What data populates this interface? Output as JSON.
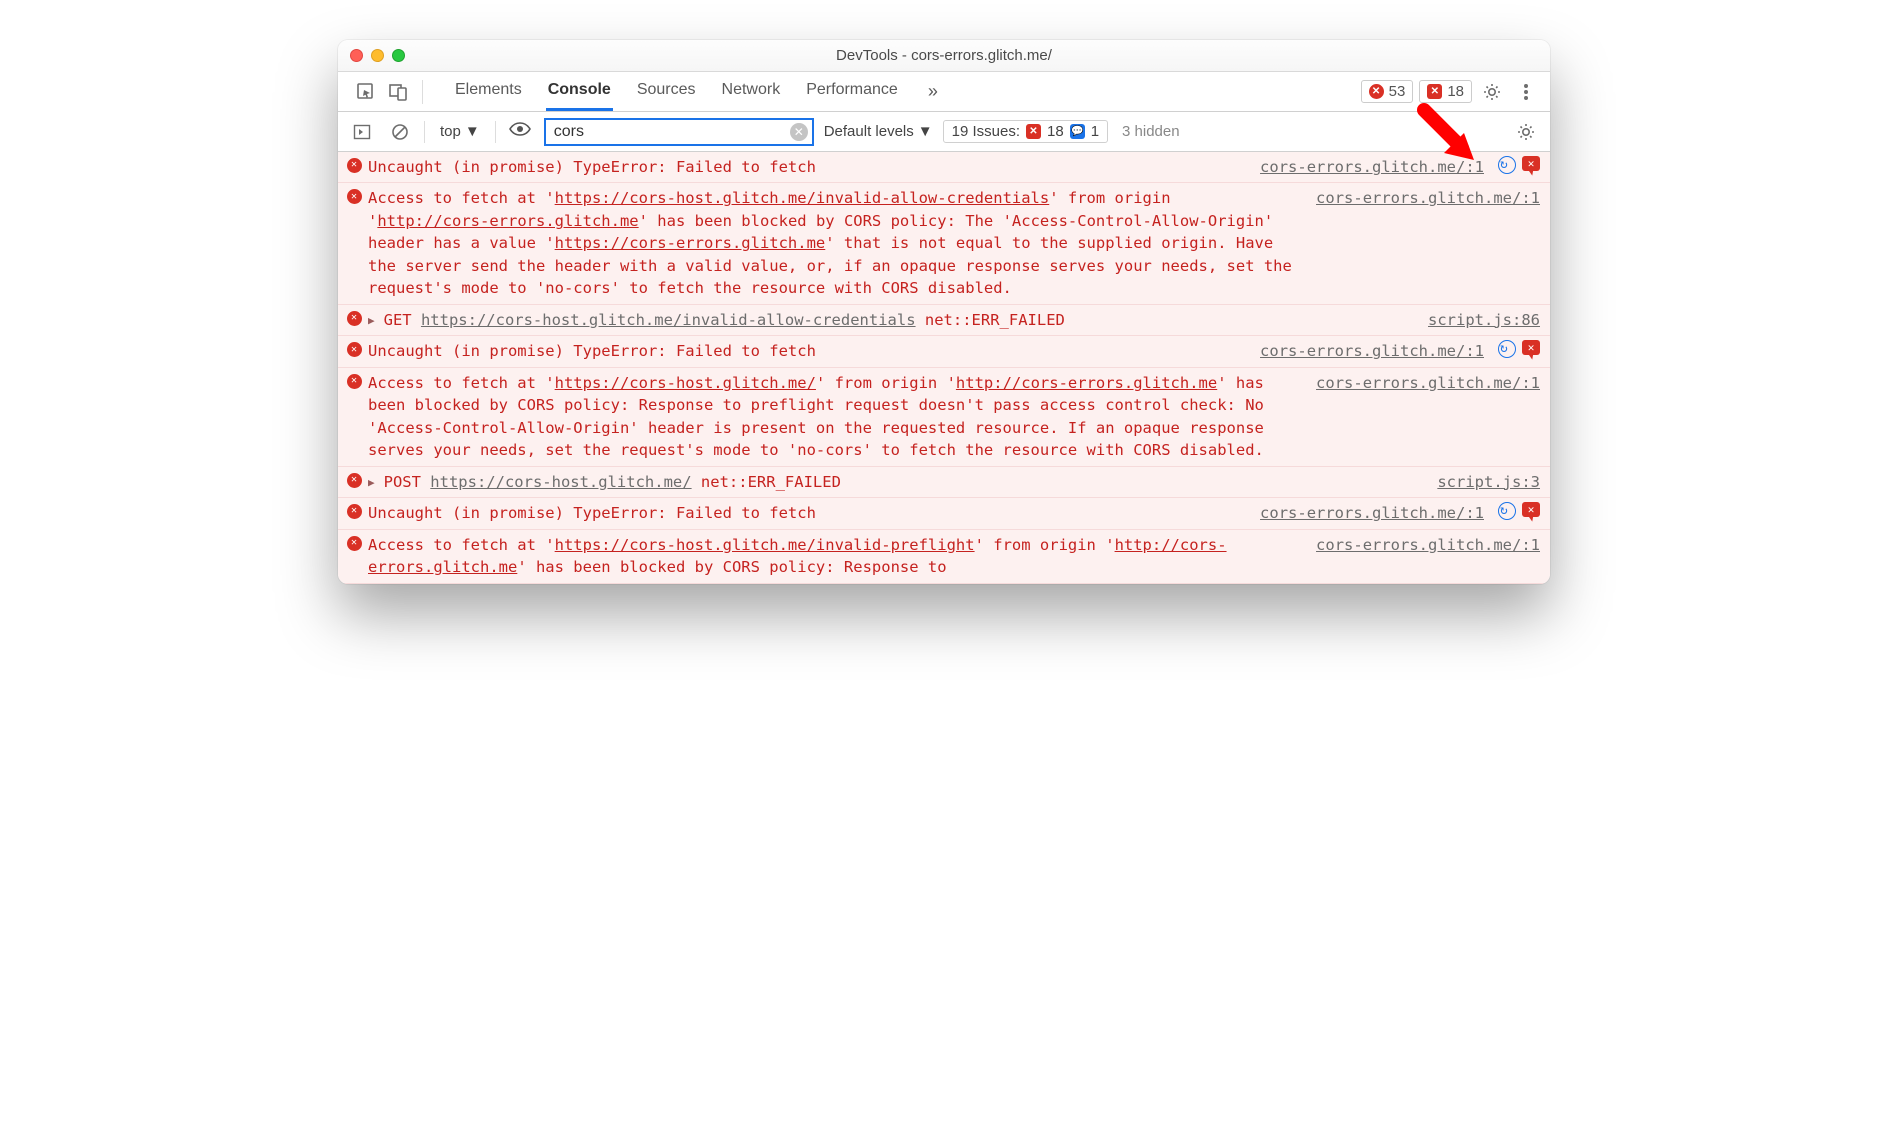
{
  "window": {
    "title": "DevTools - cors-errors.glitch.me/"
  },
  "tabs": {
    "items": [
      "Elements",
      "Console",
      "Sources",
      "Network",
      "Performance"
    ],
    "active_index": 1,
    "more": "»"
  },
  "toolbar_counts": {
    "errors": "53",
    "issues": "18"
  },
  "subtoolbar": {
    "context": "top",
    "filter_value": "cors",
    "levels": "Default levels",
    "issues_label": "19 Issues:",
    "issues_err": "18",
    "issues_msg": "1",
    "hidden": "3 hidden"
  },
  "messages": [
    {
      "kind": "error",
      "text": "Uncaught (in promise) TypeError: Failed to fetch",
      "src": "cors-errors.glitch.me/:1",
      "trail_icons": true
    },
    {
      "kind": "error",
      "segments": [
        {
          "t": "Access to fetch at '"
        },
        {
          "t": "https://cors-host.glitch.me/invalid-allow-credentials",
          "u": true
        },
        {
          "t": "' from origin '"
        },
        {
          "t": "http://cors-errors.glitch.me",
          "u": true
        },
        {
          "t": "' has been blocked by CORS policy: The 'Access-Control-Allow-Origin' header has a value '"
        },
        {
          "t": "https://cors-errors.glitch.me",
          "u": true
        },
        {
          "t": "' that is not equal to the supplied origin. Have the server send the header with a valid value, or, if an opaque response serves your needs, set the request's mode to 'no-cors' to fetch the resource with CORS disabled."
        }
      ],
      "src": "cors-errors.glitch.me/:1"
    },
    {
      "kind": "net",
      "expand": true,
      "method": "GET",
      "url": "https://cors-host.glitch.me/invalid-allow-credentials",
      "status": "net::ERR_FAILED",
      "src": "script.js:86"
    },
    {
      "kind": "error",
      "text": "Uncaught (in promise) TypeError: Failed to fetch",
      "src": "cors-errors.glitch.me/:1",
      "trail_icons": true
    },
    {
      "kind": "error",
      "segments": [
        {
          "t": "Access to fetch at '"
        },
        {
          "t": "https://cors-host.glitch.me/",
          "u": true
        },
        {
          "t": "' from origin '"
        },
        {
          "t": "http://cors-errors.glitch.me",
          "u": true
        },
        {
          "t": "' has been blocked by CORS policy: Response to preflight request doesn't pass access control check: No 'Access-Control-Allow-Origin' header is present on the requested resource. If an opaque response serves your needs, set the request's mode to 'no-cors' to fetch the resource with CORS disabled."
        }
      ],
      "src": "cors-errors.glitch.me/:1"
    },
    {
      "kind": "net",
      "expand": true,
      "method": "POST",
      "url": "https://cors-host.glitch.me/",
      "status": "net::ERR_FAILED",
      "src": "script.js:3"
    },
    {
      "kind": "error",
      "text": "Uncaught (in promise) TypeError: Failed to fetch",
      "src": "cors-errors.glitch.me/:1",
      "trail_icons": true
    },
    {
      "kind": "error",
      "segments": [
        {
          "t": "Access to fetch at '"
        },
        {
          "t": "https://cors-host.glitch.me/invalid-preflight",
          "u": true
        },
        {
          "t": "' from origin '"
        },
        {
          "t": "http://cors-errors.glitch.me",
          "u": true
        },
        {
          "t": "' has been blocked by CORS policy: Response to"
        }
      ],
      "src": "cors-errors.glitch.me/:1",
      "cutoff": true
    }
  ]
}
